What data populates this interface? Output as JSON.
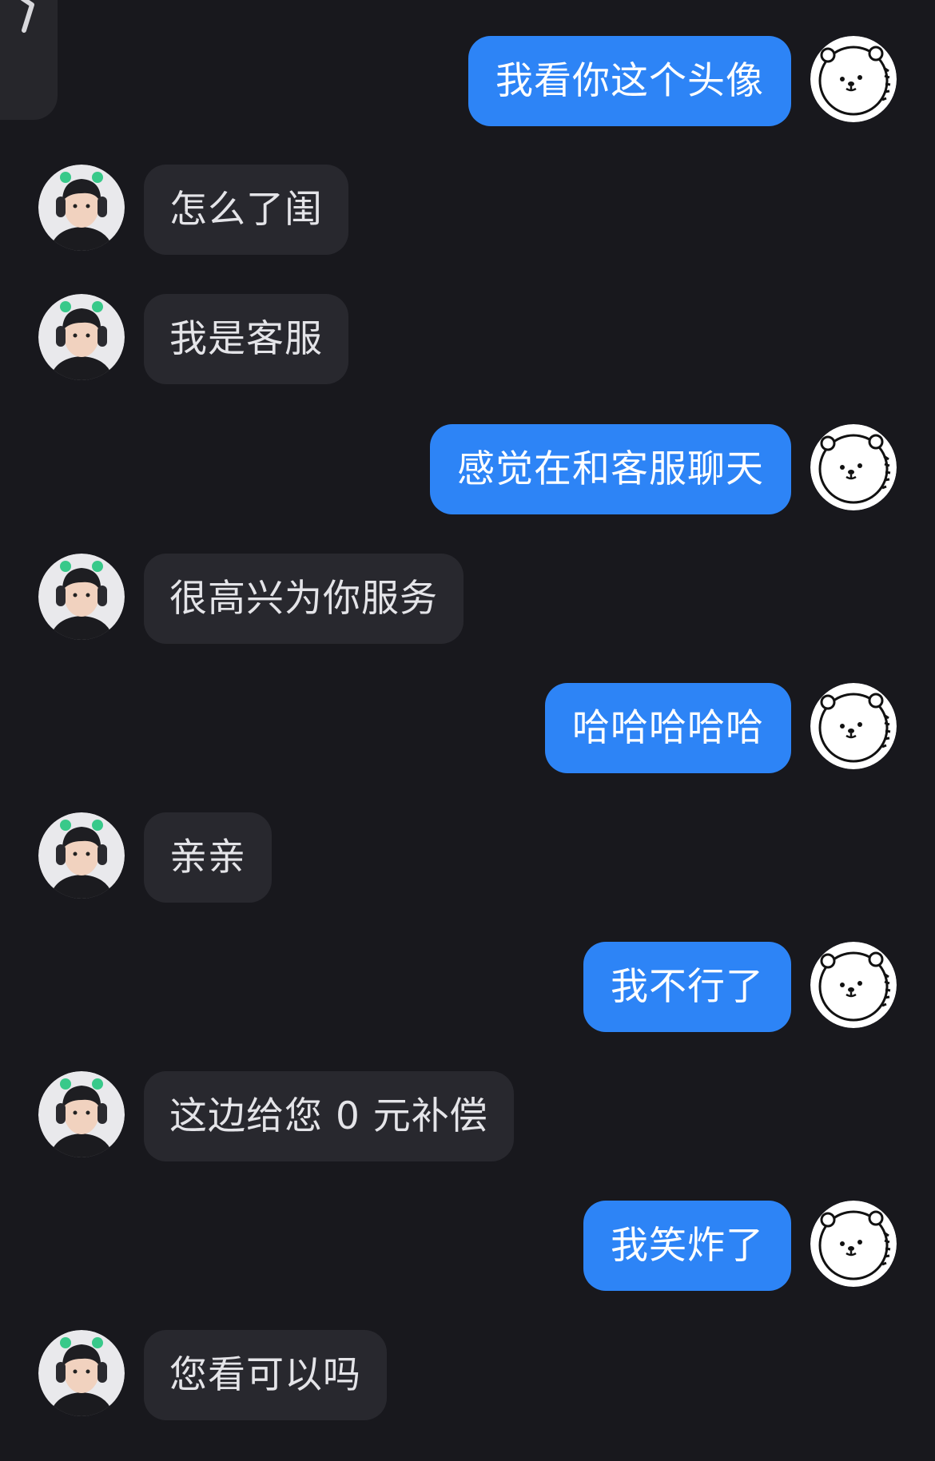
{
  "colors": {
    "background": "#18181d",
    "incoming_bubble": "#28282e",
    "outgoing_bubble": "#2d84f6",
    "incoming_text": "#e4e4e8",
    "outgoing_text": "#ffffff"
  },
  "avatars": {
    "self": "bear-avatar",
    "other": "person-with-headphones-avatar"
  },
  "messages": [
    {
      "direction": "outgoing",
      "text": "我看你这个头像"
    },
    {
      "direction": "incoming",
      "text": "怎么了闺"
    },
    {
      "direction": "incoming",
      "text": "我是客服"
    },
    {
      "direction": "outgoing",
      "text": "感觉在和客服聊天"
    },
    {
      "direction": "incoming",
      "text": "很高兴为你服务"
    },
    {
      "direction": "outgoing",
      "text": "哈哈哈哈哈"
    },
    {
      "direction": "incoming",
      "text": "亲亲"
    },
    {
      "direction": "outgoing",
      "text": "我不行了"
    },
    {
      "direction": "incoming",
      "text": "这边给您 0 元补偿"
    },
    {
      "direction": "outgoing",
      "text": "我笑炸了"
    },
    {
      "direction": "incoming",
      "text": "您看可以吗"
    }
  ]
}
